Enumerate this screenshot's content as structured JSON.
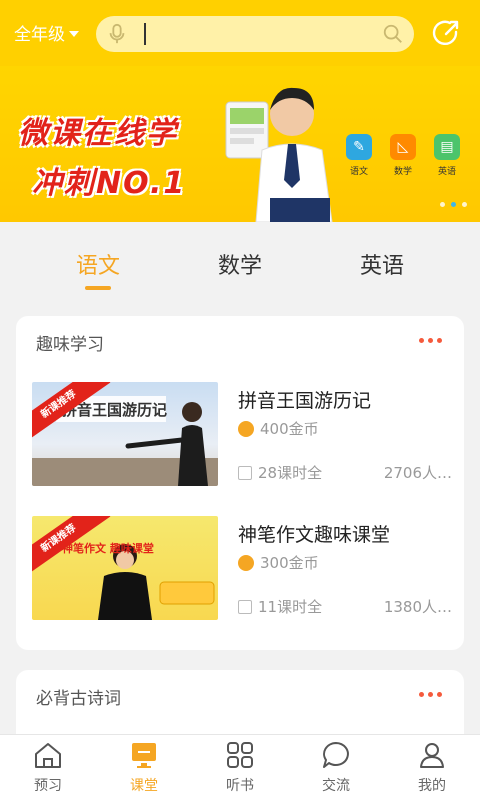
{
  "header": {
    "grade_label": "全年级",
    "search_placeholder": ""
  },
  "banner": {
    "slogan_line1": "微课在线学",
    "slogan_line2": "冲刺NO.1",
    "subjects": [
      {
        "label": "语文",
        "color": "#2EA7E0",
        "icon": "pencil-icon"
      },
      {
        "label": "数学",
        "color": "#FF8A00",
        "icon": "ruler-icon"
      },
      {
        "label": "英语",
        "color": "#4CC46B",
        "icon": "book-icon"
      }
    ],
    "active_dot": 1
  },
  "tabs": [
    {
      "label": "语文",
      "active": true
    },
    {
      "label": "数学",
      "active": false
    },
    {
      "label": "英语",
      "active": false
    }
  ],
  "sections": [
    {
      "title": "趣味学习",
      "courses": [
        {
          "badge": "新课推荐",
          "thumb_text": "拼音王国游历记",
          "title": "拼音王国游历记",
          "price": "400金币",
          "lessons": "28课时全",
          "learners": "2706人…"
        },
        {
          "badge": "新课推荐",
          "thumb_text": "神笔作文 趣味课堂",
          "title": "神笔作文趣味课堂",
          "price": "300金币",
          "lessons": "11课时全",
          "learners": "1380人…"
        }
      ]
    },
    {
      "title": "必背古诗词",
      "courses": []
    }
  ],
  "bottom_nav": [
    {
      "label": "预习",
      "icon": "home-icon",
      "active": false
    },
    {
      "label": "课堂",
      "icon": "classroom-icon",
      "active": true
    },
    {
      "label": "听书",
      "icon": "grid-icon",
      "active": false
    },
    {
      "label": "交流",
      "icon": "chat-icon",
      "active": false
    },
    {
      "label": "我的",
      "icon": "user-icon",
      "active": false
    }
  ],
  "colors": {
    "brand_yellow": "#FFD000",
    "accent_orange": "#F5A623",
    "slogan_red": "#E2231A"
  }
}
